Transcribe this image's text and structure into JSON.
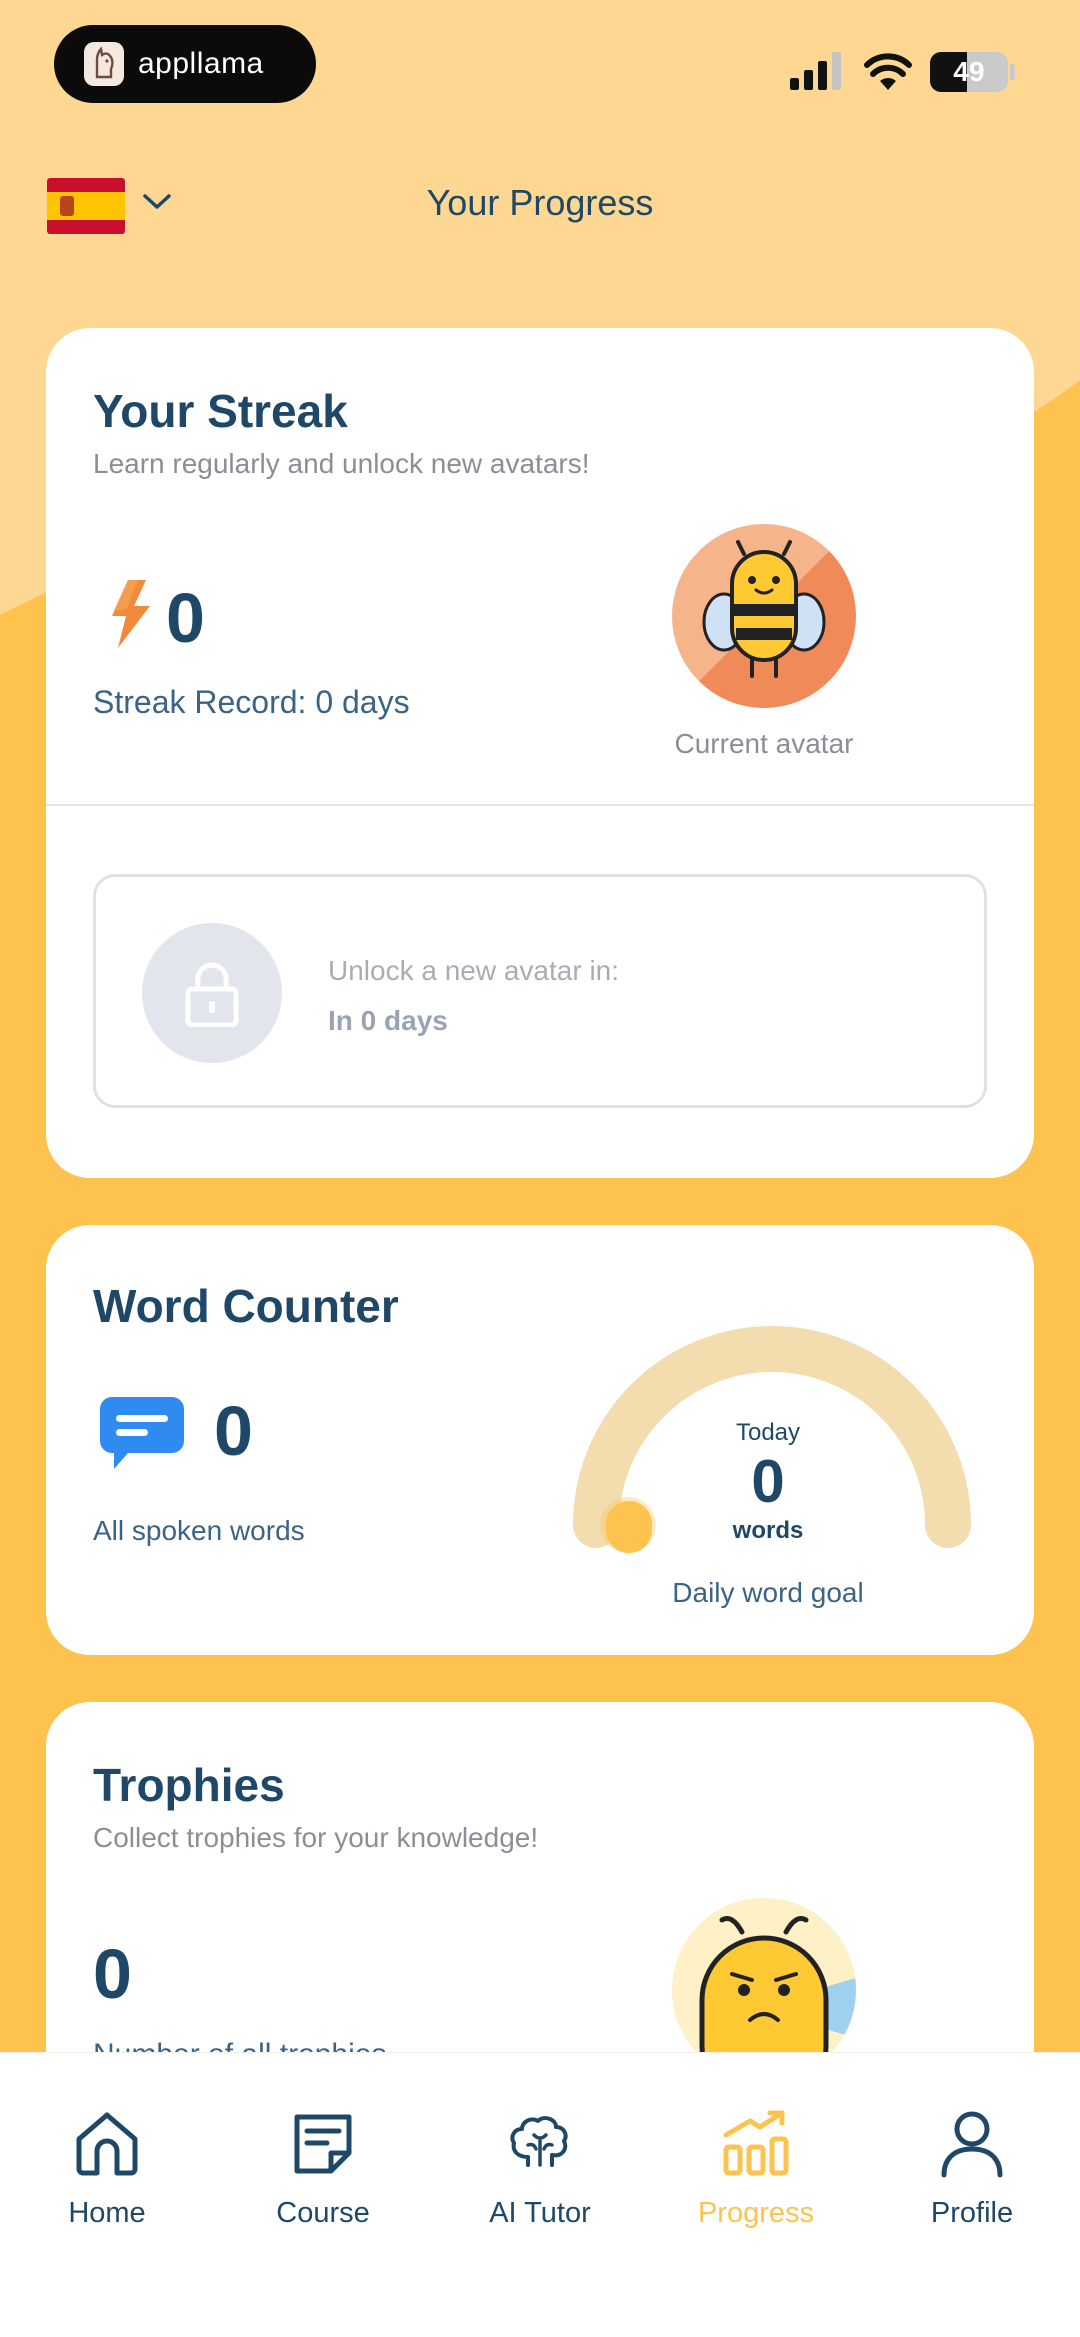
{
  "status_bar": {
    "app_name": "appllama",
    "battery": "49"
  },
  "header": {
    "title": "Your Progress",
    "language_flag": "spain-flag-icon"
  },
  "streak_card": {
    "title": "Your Streak",
    "subtitle": "Learn regularly and unlock new avatars!",
    "streak_count": "0",
    "streak_record": "Streak Record: 0 days",
    "avatar_label": "Current avatar",
    "unlock_label": "Unlock a new avatar in:",
    "unlock_value": "In 0 days"
  },
  "word_card": {
    "title": "Word Counter",
    "total_words": "0",
    "total_label": "All spoken words",
    "gauge_today": "Today",
    "gauge_value": "0",
    "gauge_unit": "words",
    "gauge_progress": 0,
    "goal_label": "Daily word goal"
  },
  "trophies_card": {
    "title": "Trophies",
    "subtitle": "Collect trophies for your knowledge!",
    "count": "0",
    "count_label": "Number of all trophies"
  },
  "nav": {
    "items": [
      {
        "label": "Home",
        "icon": "home-icon"
      },
      {
        "label": "Course",
        "icon": "course-icon"
      },
      {
        "label": "AI Tutor",
        "icon": "brain-icon"
      },
      {
        "label": "Progress",
        "icon": "chart-icon",
        "active": true
      },
      {
        "label": "Profile",
        "icon": "profile-icon"
      }
    ]
  },
  "colors": {
    "accent": "#FEC34F",
    "background_light": "#FED892",
    "text_dark": "#1F4868",
    "icon_blue": "#2F8BF0",
    "bolt_orange": "#F28A3C"
  }
}
